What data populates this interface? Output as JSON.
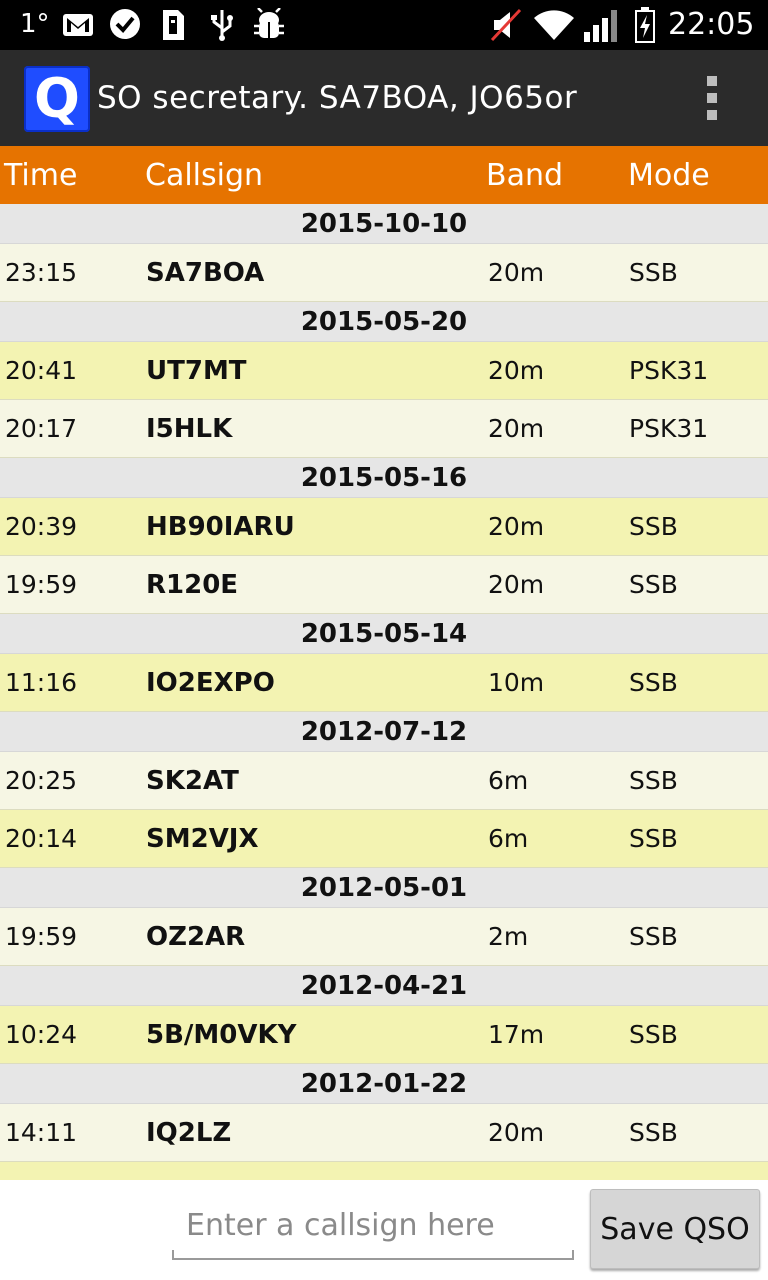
{
  "status_bar": {
    "left_indicator": "1°",
    "time": "22:05",
    "icons": [
      "gmail-icon",
      "chat-bubble-icon",
      "sd-card-icon",
      "usb-icon",
      "android-debug-icon",
      "muted-speaker-icon",
      "wifi-icon",
      "signal-icon",
      "battery-charging-icon"
    ]
  },
  "action_bar": {
    "app_icon_letter": "Q",
    "title": "SO secretary. SA7BOA, JO65or",
    "overflow_icon": "overflow-menu-icon"
  },
  "table": {
    "headers": {
      "time": "Time",
      "callsign": "Callsign",
      "band": "Band",
      "mode": "Mode"
    },
    "groups": [
      {
        "date": "2015-10-10",
        "rows": [
          {
            "time": "23:15",
            "callsign": "SA7BOA",
            "band": "20m",
            "mode": "SSB"
          }
        ]
      },
      {
        "date": "2015-05-20",
        "rows": [
          {
            "time": "20:41",
            "callsign": "UT7MT",
            "band": "20m",
            "mode": "PSK31"
          },
          {
            "time": "20:17",
            "callsign": "I5HLK",
            "band": "20m",
            "mode": "PSK31"
          }
        ]
      },
      {
        "date": "2015-05-16",
        "rows": [
          {
            "time": "20:39",
            "callsign": "HB90IARU",
            "band": "20m",
            "mode": "SSB"
          },
          {
            "time": "19:59",
            "callsign": "R120E",
            "band": "20m",
            "mode": "SSB"
          }
        ]
      },
      {
        "date": "2015-05-14",
        "rows": [
          {
            "time": "11:16",
            "callsign": "IO2EXPO",
            "band": "10m",
            "mode": "SSB"
          }
        ]
      },
      {
        "date": "2012-07-12",
        "rows": [
          {
            "time": "20:25",
            "callsign": "SK2AT",
            "band": "6m",
            "mode": "SSB"
          },
          {
            "time": "20:14",
            "callsign": "SM2VJX",
            "band": "6m",
            "mode": "SSB"
          }
        ]
      },
      {
        "date": "2012-05-01",
        "rows": [
          {
            "time": "19:59",
            "callsign": "OZ2AR",
            "band": "2m",
            "mode": "SSB"
          }
        ]
      },
      {
        "date": "2012-04-21",
        "rows": [
          {
            "time": "10:24",
            "callsign": "5B/M0VKY",
            "band": "17m",
            "mode": "SSB"
          }
        ]
      },
      {
        "date": "2012-01-22",
        "rows": [
          {
            "time": "14:11",
            "callsign": "IQ2LZ",
            "band": "20m",
            "mode": "SSB"
          }
        ]
      }
    ]
  },
  "entry": {
    "placeholder": "Enter a callsign here",
    "value": "",
    "save_label": "Save QSO"
  },
  "colors": {
    "header_orange": "#e67300",
    "row_light": "#f6f6e4",
    "row_yellow": "#f3f3b2",
    "date_row_gray": "#e6e6e6",
    "action_bar": "#2b2b2b",
    "app_icon_blue": "#1f4dff"
  }
}
